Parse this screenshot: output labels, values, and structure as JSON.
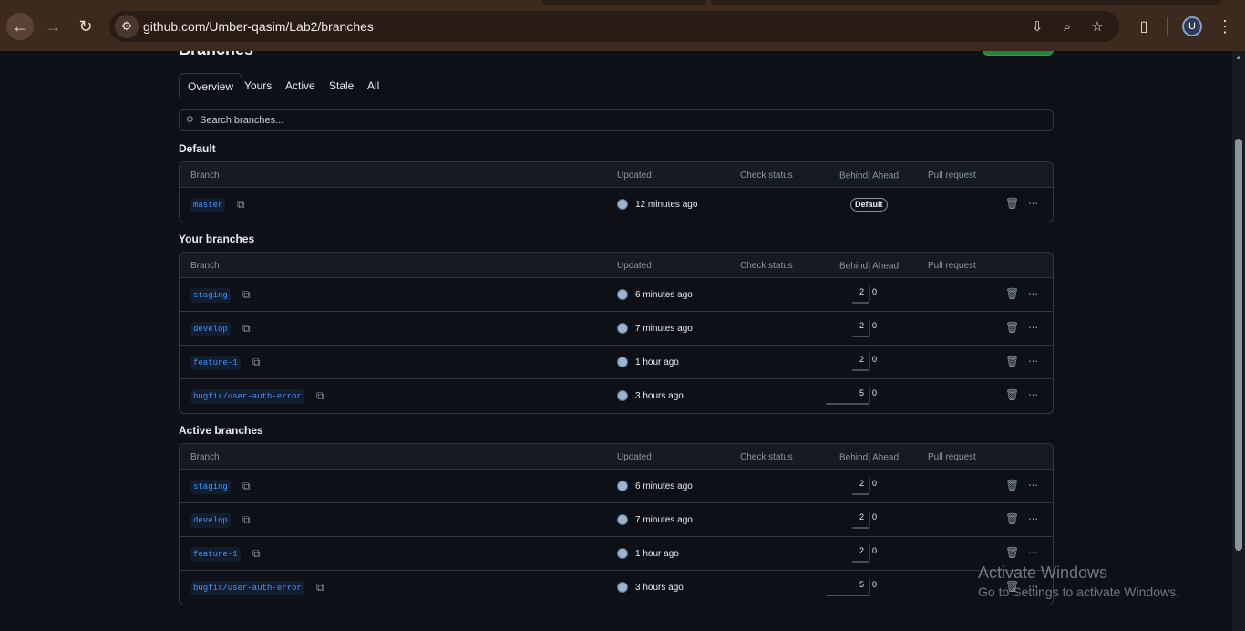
{
  "browser": {
    "url": "github.com/Umber-qasim/Lab2/branches",
    "avatar_letter": "U",
    "icons": [
      "back-icon",
      "forward-icon",
      "reload-icon",
      "site-info-icon",
      "install-icon",
      "zoom-icon",
      "star-icon",
      "extensions-icon",
      "menu-icon"
    ]
  },
  "page": {
    "heading": "Branches",
    "tabs": [
      "Overview",
      "Yours",
      "Active",
      "Stale",
      "All"
    ],
    "active_tab": "Overview",
    "search_placeholder": "Search branches..."
  },
  "columns": {
    "branch": "Branch",
    "updated": "Updated",
    "check_status": "Check status",
    "behind": "Behind",
    "ahead": "Ahead",
    "pull_request": "Pull request"
  },
  "sections": {
    "default": {
      "title": "Default",
      "rows": [
        {
          "name": "master",
          "updated": "12 minutes ago",
          "badge": "Default"
        }
      ]
    },
    "yours": {
      "title": "Your branches",
      "rows": [
        {
          "name": "staging",
          "updated": "6 minutes ago",
          "behind": "2",
          "ahead": "0"
        },
        {
          "name": "develop",
          "updated": "7 minutes ago",
          "behind": "2",
          "ahead": "0"
        },
        {
          "name": "feature-1",
          "updated": "1 hour ago",
          "behind": "2",
          "ahead": "0"
        },
        {
          "name": "bugfix/user-auth-error",
          "updated": "3 hours ago",
          "behind": "5",
          "ahead": "0"
        }
      ]
    },
    "active": {
      "title": "Active branches",
      "rows": [
        {
          "name": "staging",
          "updated": "6 minutes ago",
          "behind": "2",
          "ahead": "0"
        },
        {
          "name": "develop",
          "updated": "7 minutes ago",
          "behind": "2",
          "ahead": "0"
        },
        {
          "name": "feature-1",
          "updated": "1 hour ago",
          "behind": "2",
          "ahead": "0"
        },
        {
          "name": "bugfix/user-auth-error",
          "updated": "3 hours ago",
          "behind": "5",
          "ahead": "0"
        }
      ]
    }
  },
  "watermark": {
    "title": "Activate Windows",
    "subtitle": "Go to Settings to activate Windows."
  }
}
